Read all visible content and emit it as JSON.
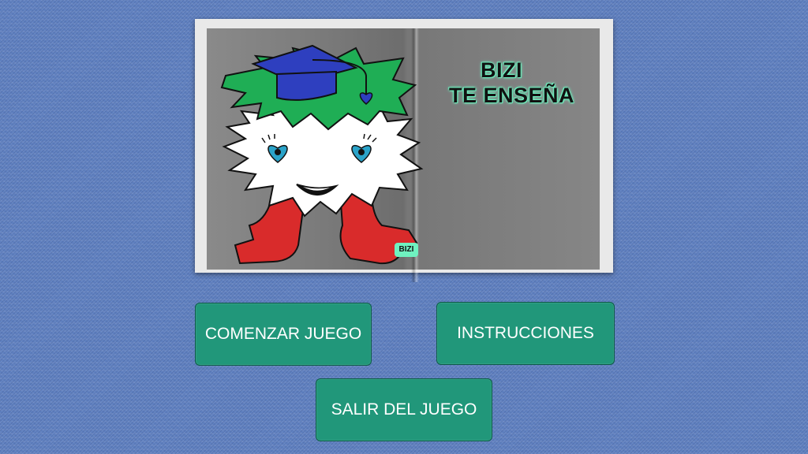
{
  "book": {
    "title_line1": "BIZI",
    "title_line2": "TE ENSEÑA",
    "badge": "BIZI"
  },
  "menu": {
    "start_label": "COMENZAR JUEGO",
    "instructions_label": "INSTRUCCIONES",
    "exit_label": "SALIR DEL JUEGO"
  },
  "colors": {
    "background": "#5f80c0",
    "button": "#21977a",
    "title_glow": "#6ff2c0",
    "hat": "#2e3fbf",
    "hair": "#1fae55",
    "legs": "#d92b2b"
  }
}
